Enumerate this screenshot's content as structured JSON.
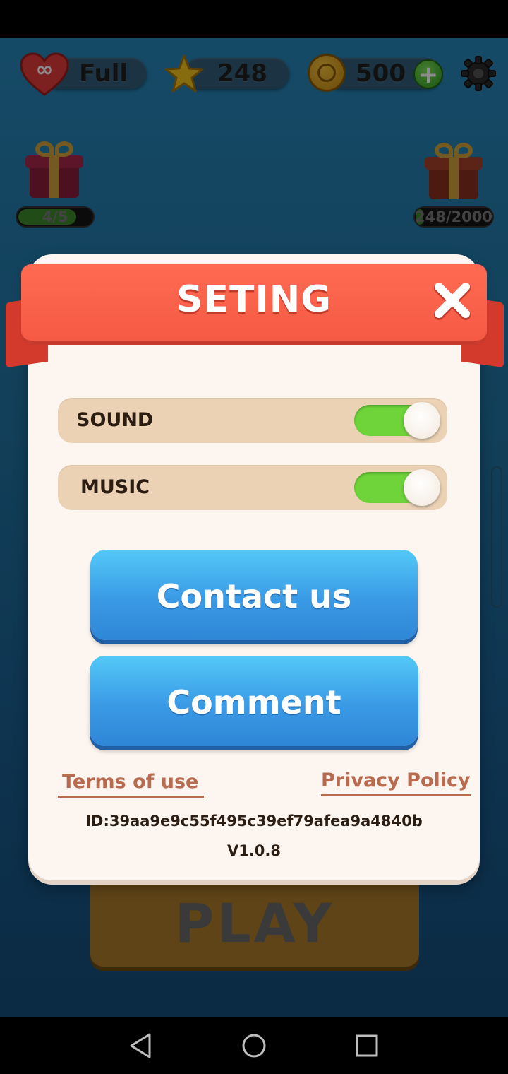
{
  "hud": {
    "lives_label": "Full",
    "stars_count": "248",
    "coins_count": "500",
    "plus_label": "+"
  },
  "gifts": {
    "left_progress": "4/5",
    "left_progress_fraction": 0.8,
    "right_progress": "248/2000",
    "right_progress_fraction": 0.124
  },
  "play_label": "PLAY",
  "dialog": {
    "title": "SETING",
    "close_icon": "close-icon",
    "toggles": [
      {
        "label": "SOUND",
        "on": true
      },
      {
        "label": "MUSIC",
        "on": true
      }
    ],
    "contact_label": "Contact us",
    "comment_label": "Comment",
    "terms_label": "Terms of use",
    "privacy_label": "Privacy Policy",
    "id_text": "ID:39aa9e9c55f495c39ef79afea9a4840b",
    "version_text": "V1.0.8"
  },
  "colors": {
    "banner": "#f55a45",
    "switch_on": "#6ed43a",
    "button_blue": "#3a9ae6",
    "link": "#b86b4f"
  }
}
